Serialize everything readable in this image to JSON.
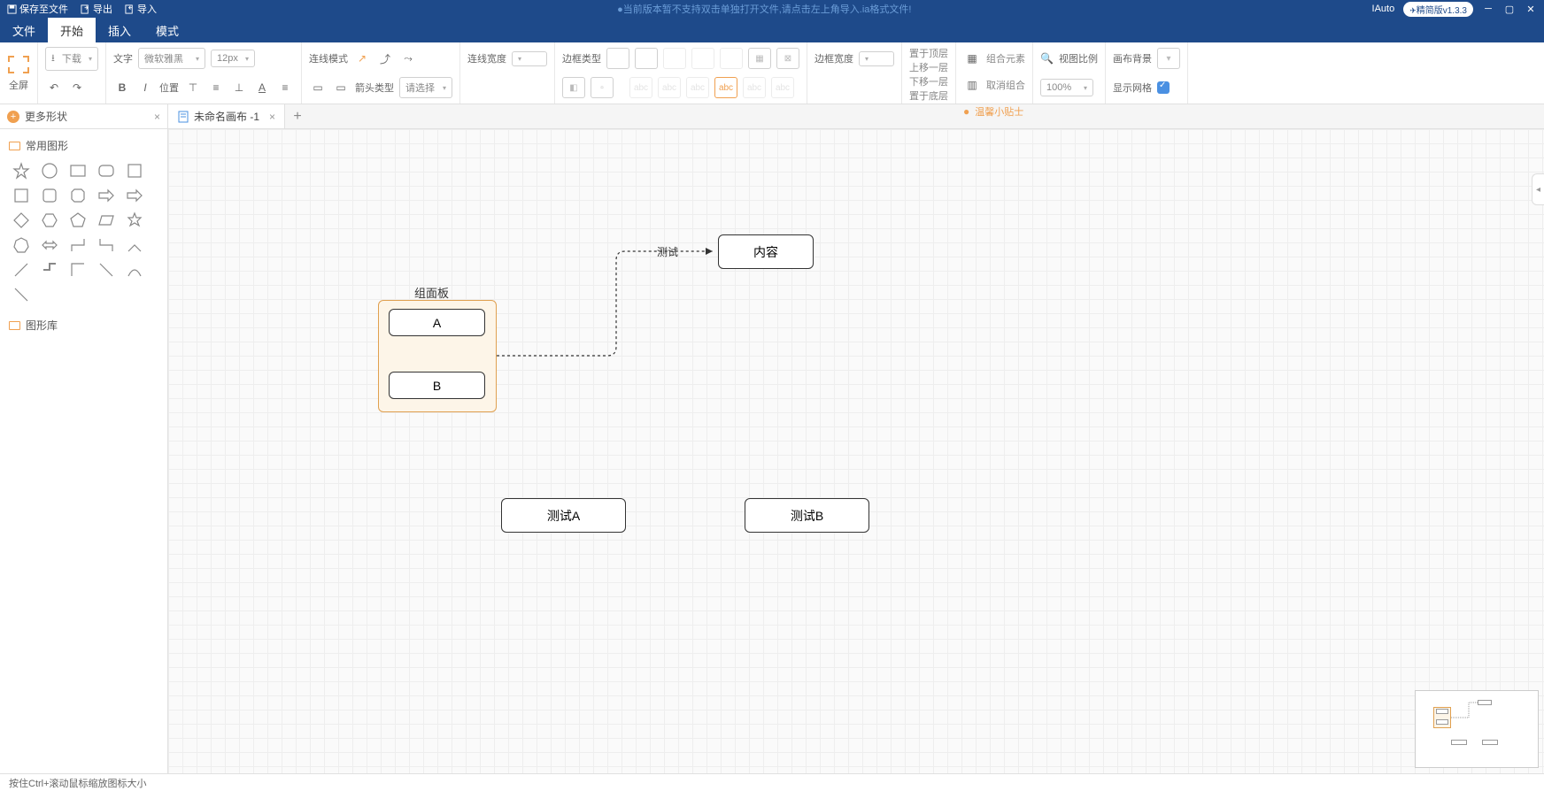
{
  "titlebar": {
    "save": "保存至文件",
    "export": "导出",
    "import": "导入",
    "notice": "●当前版本暂不支持双击单独打开文件,请点击左上角导入.ia格式文件!",
    "app_name": "IAuto",
    "version": "精简版v1.3.3"
  },
  "menu": {
    "items": [
      "文件",
      "开始",
      "插入",
      "模式"
    ],
    "active_index": 1
  },
  "ribbon": {
    "fullscreen": "全屏",
    "download": "下载",
    "text_label": "文字",
    "font_family": "微软雅黑",
    "font_size": "12px",
    "position": "位置",
    "line_mode": "连线模式",
    "line_width": "连线宽度",
    "arrow_type": "箭头类型",
    "arrow_select": "请选择",
    "border_type": "边框类型",
    "border_width": "边框宽度",
    "abc": "abc",
    "layer": {
      "top": "置于顶层",
      "up": "上移一层",
      "down": "下移一层",
      "bottom": "置于底层"
    },
    "group": {
      "group": "组合元素",
      "ungroup": "取消组合",
      "tip": "温馨小贴士"
    },
    "view_ratio": "视图比例",
    "zoom": "100%",
    "canvas_bg": "画布背景",
    "show_grid": "显示网格"
  },
  "sidebar": {
    "more_shapes": "更多形状",
    "common_shapes": "常用图形",
    "shape_library": "图形库"
  },
  "tab": {
    "name": "未命名画布 -1"
  },
  "canvas": {
    "group_title": "组面板",
    "node_a": "A",
    "node_b": "B",
    "node_content": "内容",
    "node_test_a": "测试A",
    "node_test_b": "测试B",
    "edge_label": "测试"
  },
  "statusbar": {
    "hint": "按住Ctrl+滚动鼠标缩放图标大小"
  }
}
